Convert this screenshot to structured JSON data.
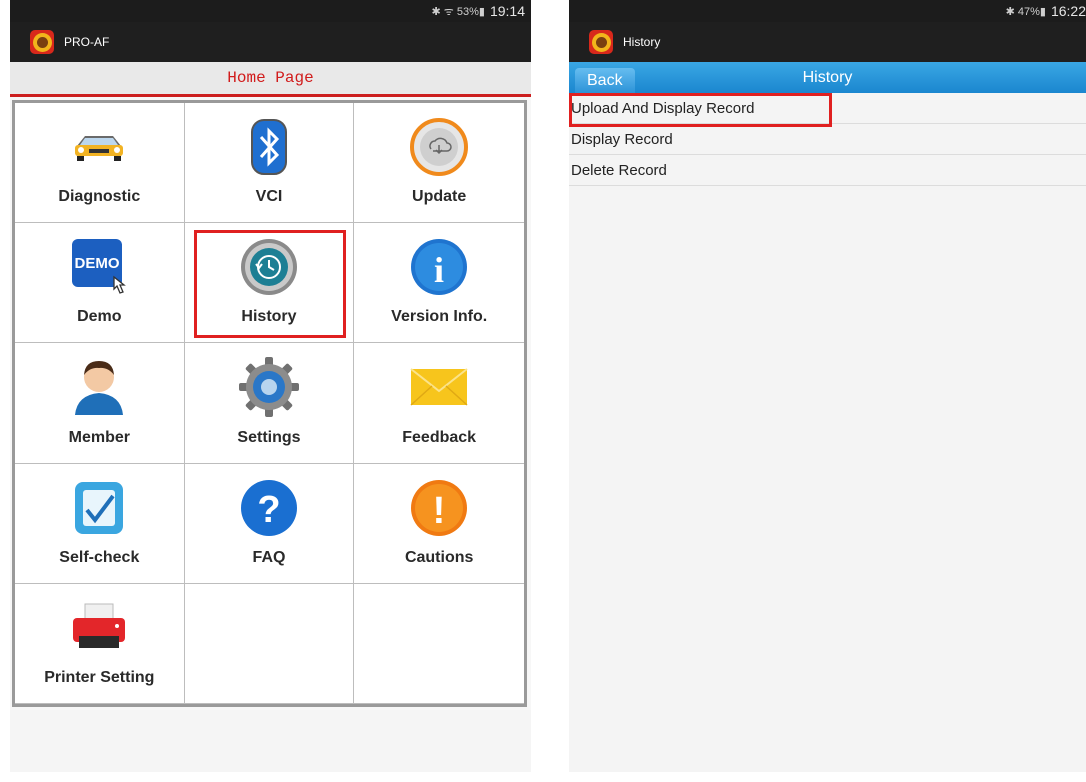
{
  "left_screen": {
    "status": {
      "icons": "✱ ᯤ 53%▮",
      "time": "19:14"
    },
    "app_title": "PRO-AF",
    "home_title": "Home Page",
    "grid": [
      {
        "label": "Diagnostic",
        "icon": "car-icon"
      },
      {
        "label": "VCI",
        "icon": "bluetooth-icon"
      },
      {
        "label": "Update",
        "icon": "cloud-download-icon"
      },
      {
        "label": "Demo",
        "icon": "demo-icon",
        "icon_text": "DEMO"
      },
      {
        "label": "History",
        "icon": "history-clock-icon"
      },
      {
        "label": "Version Info.",
        "icon": "info-icon",
        "icon_text": "i"
      },
      {
        "label": "Member",
        "icon": "user-icon"
      },
      {
        "label": "Settings",
        "icon": "gear-icon"
      },
      {
        "label": "Feedback",
        "icon": "envelope-icon"
      },
      {
        "label": "Self-check",
        "icon": "checklist-icon"
      },
      {
        "label": "FAQ",
        "icon": "question-icon",
        "icon_text": "?"
      },
      {
        "label": "Cautions",
        "icon": "warning-icon",
        "icon_text": "!"
      },
      {
        "label": "Printer Setting",
        "icon": "printer-icon"
      }
    ]
  },
  "right_screen": {
    "status": {
      "icons": "✱ 47%▮",
      "time": "16:22"
    },
    "app_title": "History",
    "back_label": "Back",
    "page_title": "History",
    "items": [
      {
        "label": "Upload And Display Record"
      },
      {
        "label": "Display Record"
      },
      {
        "label": "Delete Record"
      }
    ]
  },
  "colors": {
    "highlight": "#e02020",
    "header_red": "#d11c1c",
    "title_blue": "#1b86cf"
  }
}
